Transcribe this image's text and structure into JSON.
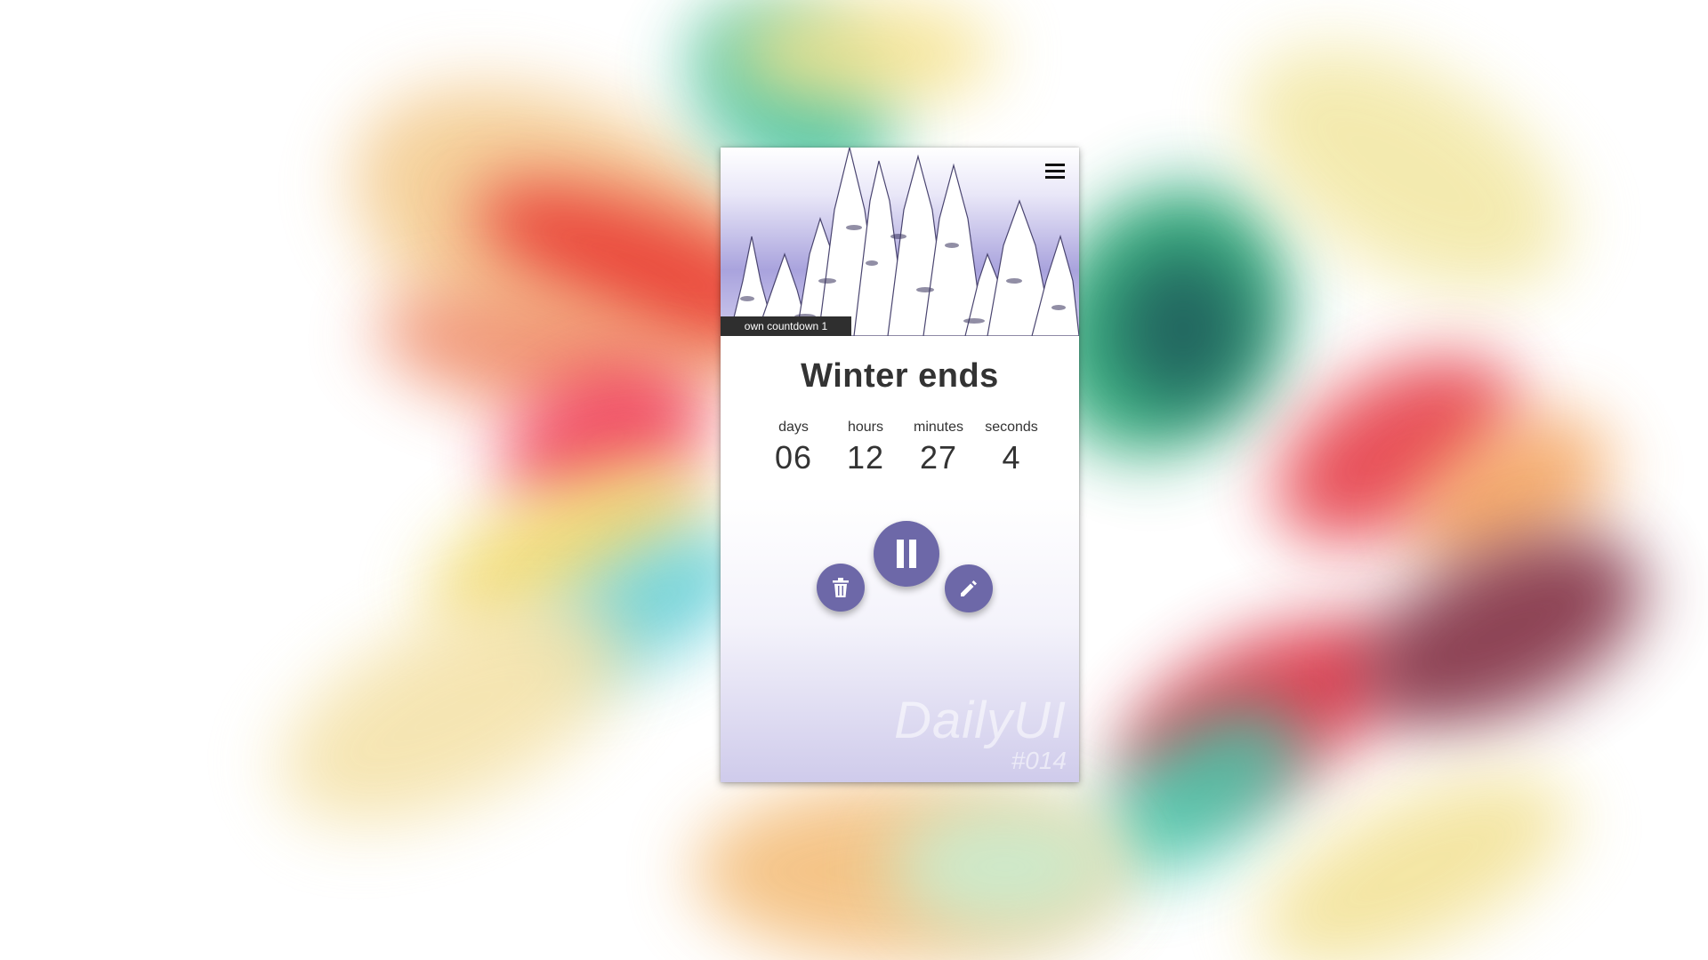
{
  "card": {
    "tag": "own countdown 1",
    "title": "Winter ends",
    "timer": {
      "units": [
        {
          "label": "days",
          "value": "06"
        },
        {
          "label": "hours",
          "value": "12"
        },
        {
          "label": "minutes",
          "value": "27"
        },
        {
          "label": "seconds",
          "value": "4"
        }
      ]
    },
    "watermark": {
      "main": "DailyUI",
      "sub": "#014"
    }
  },
  "icons": {
    "menu": "menu-icon",
    "pause": "pause-icon",
    "delete": "trash-icon",
    "edit": "pencil-icon"
  },
  "colors": {
    "accent": "#6d68a8",
    "tag_bg": "#2f2f2f",
    "text": "#333333"
  }
}
